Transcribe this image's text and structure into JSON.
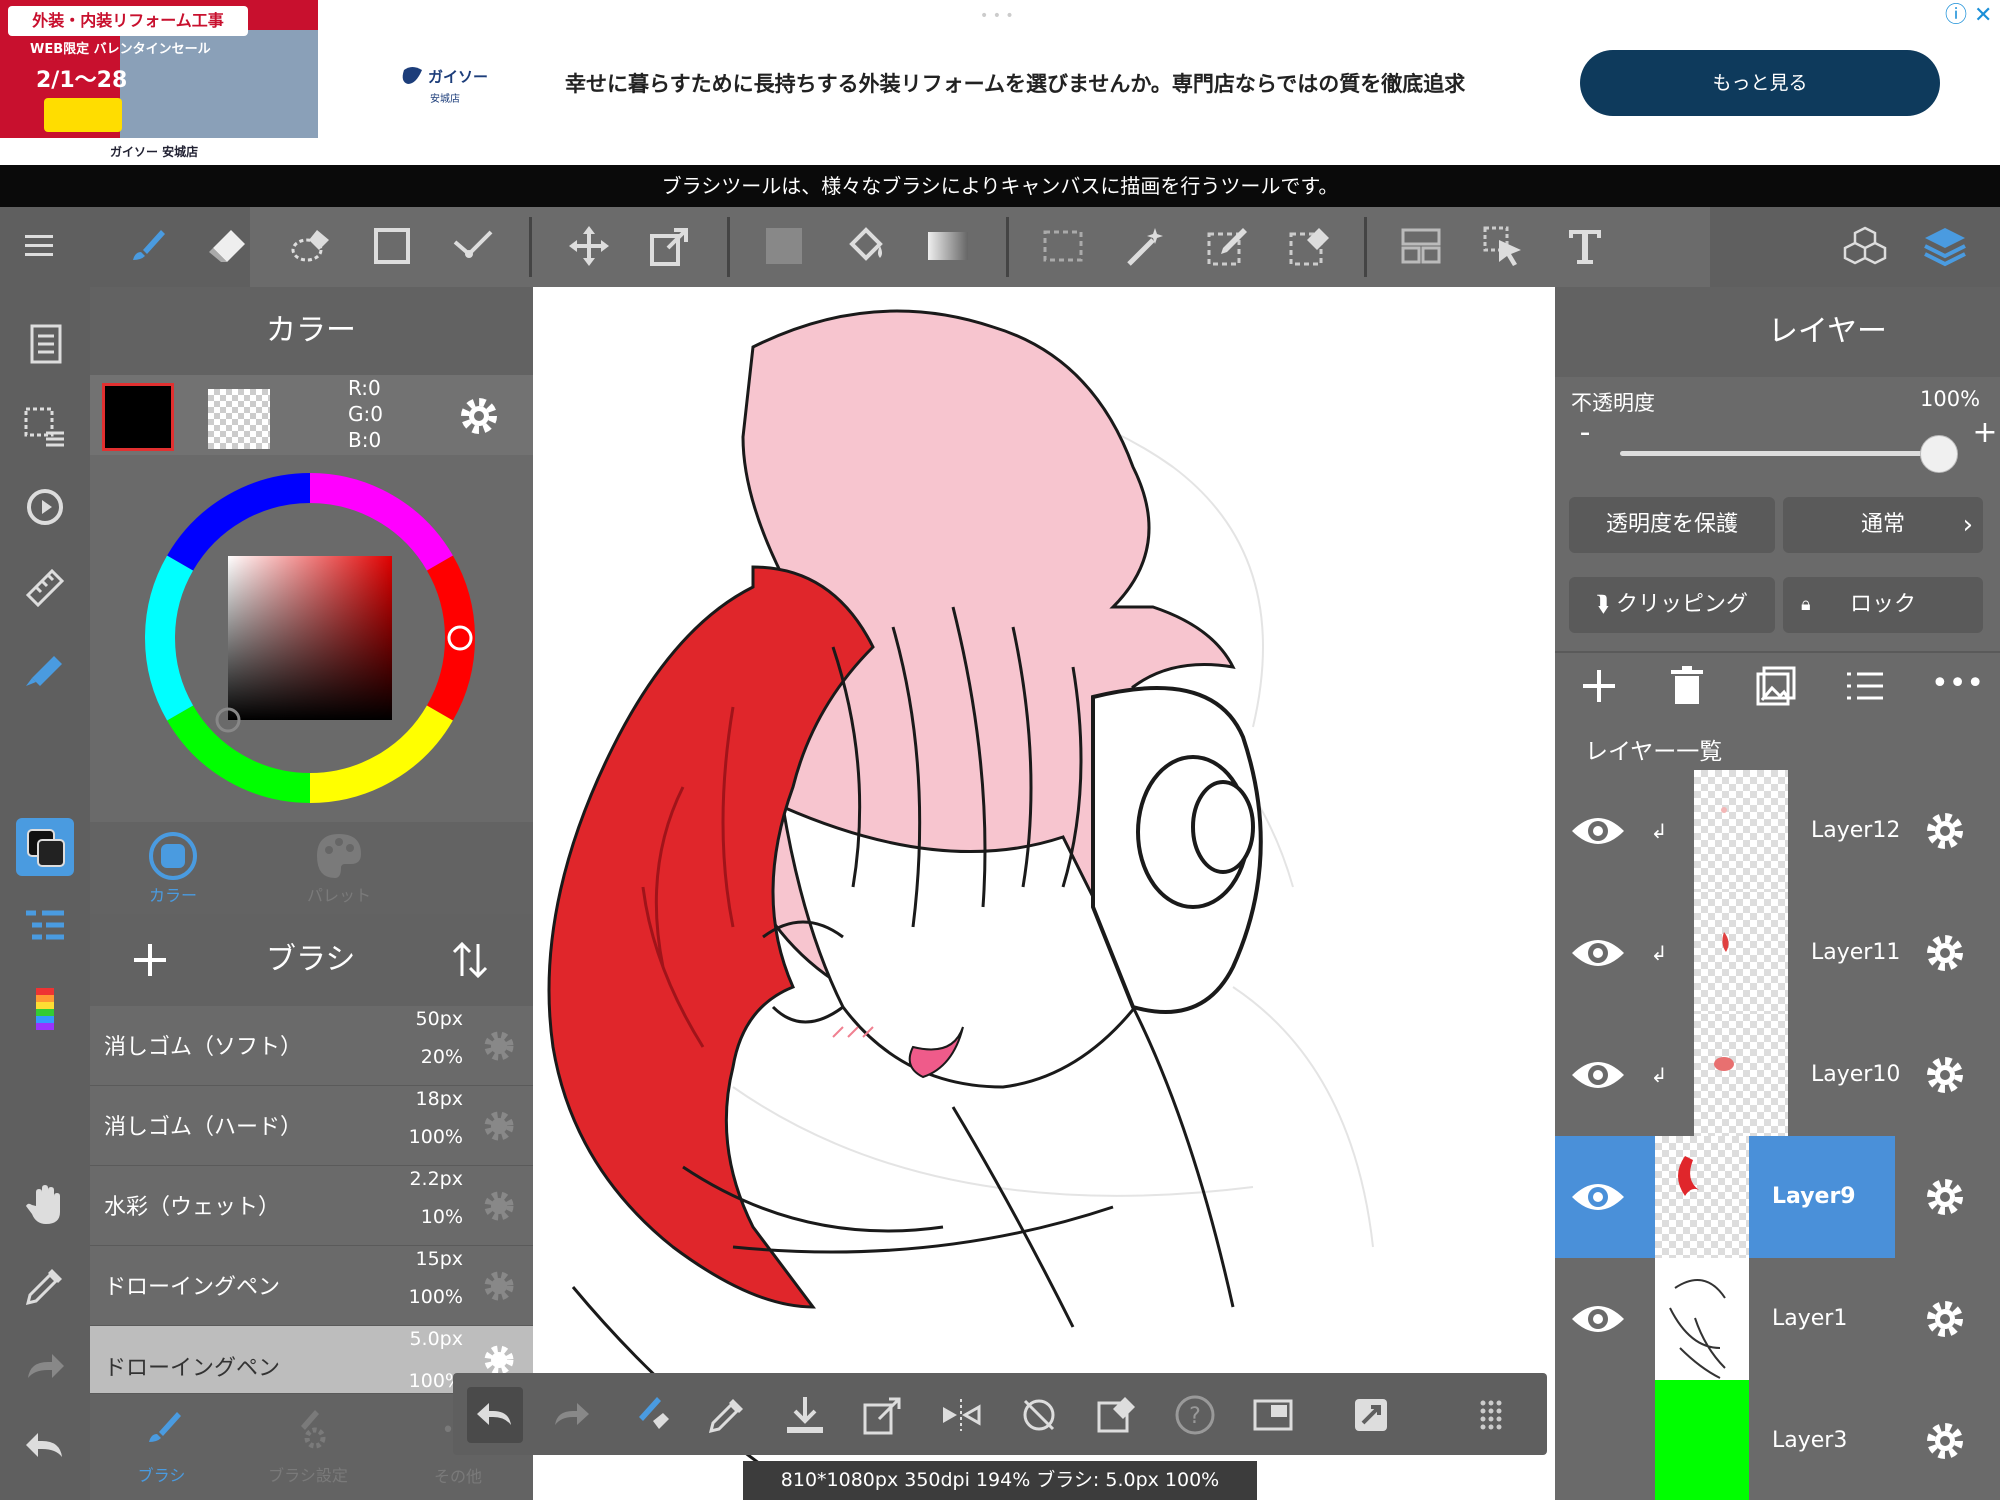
{
  "ad": {
    "image_line1": "外装・内装リフォーム工事",
    "image_line2": "WEB限定 バレンタインセール",
    "image_date": "2/1〜28",
    "image_logo": "ガイソー 安城店",
    "brand": "ガイソー",
    "brand_sub": "安城店",
    "headline": "幸せに暮らすために長持ちする外装リフォームを選びませんか。専門店ならではの質を徹底追求",
    "cta": "もっと見る"
  },
  "tooltip": "ブラシツールは、様々なブラシによりキャンバスに描画を行うツールです。",
  "color_panel": {
    "title": "カラー",
    "r": "R:0",
    "g": "G:0",
    "b": "B:0",
    "tabs": [
      "カラー",
      "パレット"
    ]
  },
  "brush_panel": {
    "title": "ブラシ",
    "brushes": [
      {
        "name": "消しゴム（ソフト）",
        "size": "50px",
        "opacity": "20%"
      },
      {
        "name": "消しゴム（ハード）",
        "size": "18px",
        "opacity": "100%"
      },
      {
        "name": "水彩（ウェット）",
        "size": "2.2px",
        "opacity": "10%"
      },
      {
        "name": "ドローイングペン",
        "size": "15px",
        "opacity": "100%"
      },
      {
        "name": "ドローイングペン",
        "size": "5.0px",
        "opacity": "100%"
      }
    ],
    "tabs": [
      "ブラシ",
      "ブラシ設定",
      "その他"
    ]
  },
  "layer_panel": {
    "title": "レイヤー",
    "opacity_label": "不透明度",
    "opacity_value": "100%",
    "opacity_fraction": 1.0,
    "minus": "-",
    "plus": "+",
    "protect_alpha": "透明度を保護",
    "blend_mode": "通常",
    "clipping": "クリッピング",
    "lock": "ロック",
    "list_title": "レイヤー一覧",
    "layers": [
      {
        "name": "Layer12",
        "selected": false,
        "clipped": true
      },
      {
        "name": "Layer11",
        "selected": false,
        "clipped": true
      },
      {
        "name": "Layer10",
        "selected": false,
        "clipped": true
      },
      {
        "name": "Layer9",
        "selected": true,
        "clipped": false
      },
      {
        "name": "Layer1",
        "selected": false,
        "clipped": false
      },
      {
        "name": "Layer3",
        "selected": false,
        "clipped": false
      }
    ]
  },
  "status_bar": "810*1080px 350dpi 194% ブラシ: 5.0px 100%",
  "colors": {
    "accent_blue": "#4a9be0",
    "selected_layer": "#4a90d9",
    "hair_red": "#e0262b",
    "hair_pink": "#f7c5cf",
    "layer3_green": "#00ff00"
  }
}
